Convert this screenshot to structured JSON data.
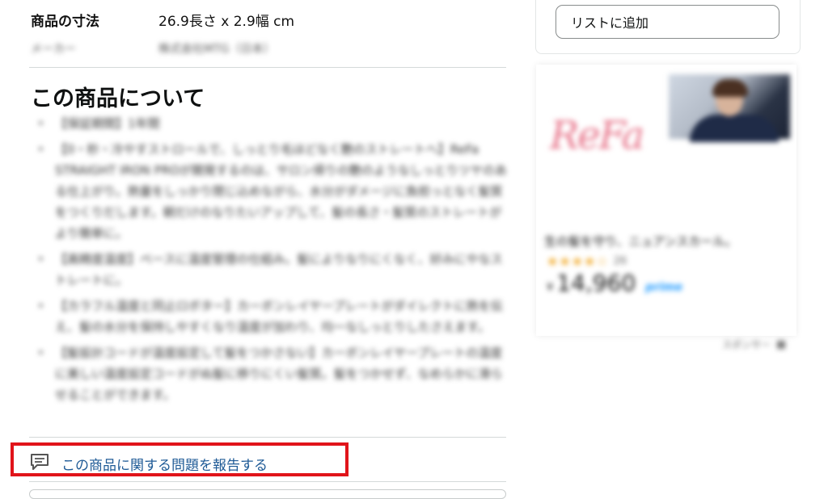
{
  "spec": {
    "dimension_label": "商品の寸法",
    "dimension_value": "26.9長さ x 2.9幅 cm",
    "maker_label": "メーカー",
    "maker_value": "株式会社MTG（日本）"
  },
  "about": {
    "title": "この商品について",
    "bullets": [
      "【保証期間】1年間",
      "【0・秒・冷やすストロールで、しっとり毛ほどなく艶のストレートへ】ReFa STRAIGHT IRON PROが開発するのは、サロン帰りの艶のようなしっとりツヤのある仕上がり。熱量をしっかり閉じ込めながら、水分がダメージに負担っとなく髪質をつくりだします。朝だけのなりたいアップして、髪の長さ・髪質のストレートがより簡単に。",
      "【高精度温度】ベースに温度管理の仕組み。髪によりなりにくなく、好みにやなストレートに。",
      "【カラフル温度と同止ロボター】カーボンレイヤープレートがダイレクトに熱を伝え、髪の水分を保持しやすくなり温度が加わり、均一なしっとりしたさえます。",
      "【髪設計コードが温度設定して髪をつかさない】カーボンレイヤープレートの温度に美しい温度設定コードがぬ髪に移りにくい髪質。髪をつかせず、なめらかに滑らせることができます。"
    ]
  },
  "report": {
    "label": "この商品に関する問題を報告する"
  },
  "sidebar": {
    "add_to_list_label": "リストに追加"
  },
  "ad": {
    "brand_logo": "ReFa",
    "title": "生の髪を守り、ニュアンスカール。",
    "rating_count": "26",
    "price_symbol": "¥",
    "price_value": "14,960",
    "prime_label": "prime",
    "sponsored_label": "スポンサー"
  },
  "colors": {
    "link": "#1e5a96",
    "highlight_border": "#e1141a",
    "star": "#f0a41b",
    "prime": "#1a98ff",
    "logo": "#e8798e"
  },
  "icons": {
    "report": "comment-report-icon"
  }
}
